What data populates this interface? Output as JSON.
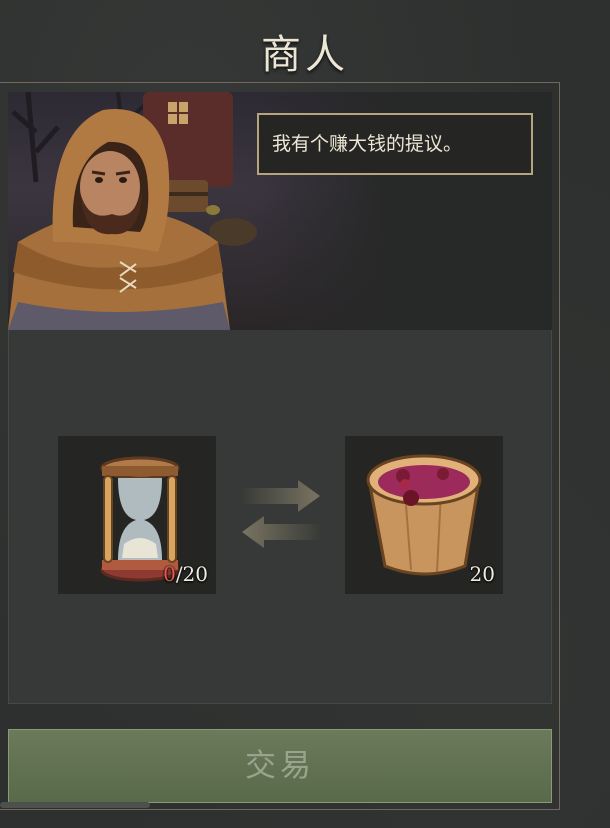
{
  "title": "商人",
  "merchant": {
    "dialogue": "我有个赚大钱的提议。"
  },
  "trade": {
    "give": {
      "icon": "hourglass-icon",
      "have": "0",
      "need": "/20"
    },
    "receive": {
      "icon": "berry-bucket-icon",
      "amount": "20"
    },
    "exchange_icon": "exchange-arrows-icon"
  },
  "trade_button": {
    "label": "交易"
  },
  "colors": {
    "title": "#ece6d4",
    "speech_border": "#b6a47e",
    "insufficient": "#e25a52",
    "button": "#637352"
  }
}
